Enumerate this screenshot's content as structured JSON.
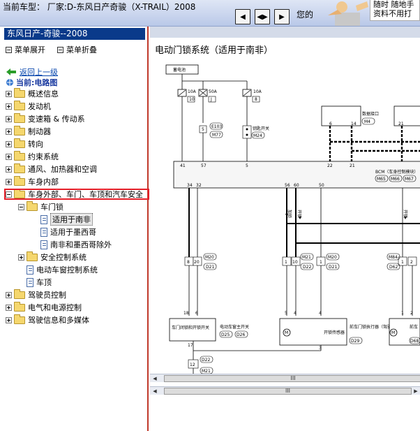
{
  "topbar": {
    "car_title": "当前车型：  厂家:D-东风日产奇骏（X-TRAIL）2008",
    "nav": [
      "◀",
      "◀▶",
      "▶"
    ],
    "hello": "您的",
    "promo_line1": "随时 随地手",
    "promo_line2": "资料不用打"
  },
  "tree": {
    "header": "东风日产-奇骏--2008",
    "expand_all": "菜单展开",
    "collapse_all": "菜单折叠",
    "back": "返回上一级",
    "current": "当前:电路图",
    "items": [
      {
        "label": "概述信息"
      },
      {
        "label": "发动机"
      },
      {
        "label": "变速箱 & 传动系"
      },
      {
        "label": "制动器"
      },
      {
        "label": "转向"
      },
      {
        "label": "约束系统"
      },
      {
        "label": "通风、加热器和空调"
      },
      {
        "label": "车身内部"
      },
      {
        "label": "车身外部、车门、车顶和汽车安全"
      },
      {
        "label": "车门锁"
      },
      {
        "label": "适用于南非"
      },
      {
        "label": "适用于墨西哥"
      },
      {
        "label": "南非和墨西哥除外"
      },
      {
        "label": "安全控制系统"
      },
      {
        "label": "电动车窗控制系统"
      },
      {
        "label": "车顶"
      },
      {
        "label": "驾驶员控制"
      },
      {
        "label": "电气和电源控制"
      },
      {
        "label": "驾驶信息和多媒体"
      }
    ]
  },
  "diagram": {
    "title": "电动门锁系统（适用于南非）",
    "battery": "蓄电池",
    "fuses": [
      {
        "amp": "10A",
        "num": "10"
      },
      {
        "amp": "50A",
        "num": "J"
      },
      {
        "amp": "10A",
        "num": "8"
      }
    ],
    "e103": "E103",
    "m77": "M77",
    "key_switch": "钥匙开关",
    "m24": "M24",
    "data_link": "数据接口",
    "m4": "M4",
    "bcm": "BCM（车身控制模块）",
    "bcm_connectors": [
      "M65",
      "M66",
      "M67"
    ],
    "pins_top": [
      "41",
      "57",
      "5",
      "22",
      "21",
      "6",
      "14",
      "21"
    ],
    "pins_bcm_bottom": [
      "34",
      "32",
      "56",
      "60",
      "50"
    ],
    "lock_label": "加锁",
    "unlock_label": "开锁",
    "connectors": [
      "M20",
      "D21",
      "M21",
      "D22",
      "M20",
      "D21",
      "M84",
      "D62"
    ],
    "pin_nums": [
      "8",
      "20",
      "1",
      "10",
      "1",
      "1",
      "2"
    ],
    "door_switch": "车门闭锁和开锁开关",
    "window_switch": "电动车窗主开关",
    "d25": "D25",
    "d26": "D26",
    "unlock_sensor": "开锁传感器",
    "actuator_front": "前车门锁执行器（驾驶员侧）",
    "d29": "D29",
    "actuator_right": "前车",
    "d68": "D68",
    "pins_lower": [
      "18",
      "6",
      "5",
      "4",
      "17",
      "3",
      "12",
      "1",
      "2"
    ],
    "d22b": "D22",
    "m21b": "M21"
  },
  "scroll": {
    "thumb": "III"
  }
}
